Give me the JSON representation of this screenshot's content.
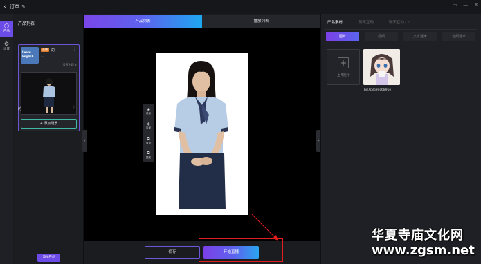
{
  "titlebar": {
    "back_icon": "‹",
    "title": "订单",
    "edit_icon": "✎",
    "window_controls": [
      "▭",
      "—",
      "✕"
    ]
  },
  "rail": [
    {
      "label": "产品",
      "icon": "cube-icon",
      "active": true
    },
    {
      "label": "设置",
      "icon": "gear-icon",
      "active": false
    }
  ],
  "product_panel": {
    "title": "产品列表",
    "card": {
      "thumb_text_1": "Learn",
      "thumb_text_2": "English",
      "badge": "直播",
      "name": "的",
      "subtitle": "…",
      "link": "设置主题 ∨",
      "scene_name": "的"
    },
    "add_scene_label": "+ 添加场景",
    "add_product_label": "添加产品"
  },
  "tabs": {
    "product_list": "产品列表",
    "playback_list": "播放列表"
  },
  "canvas_tools": [
    {
      "label": "前景",
      "icon": "layers-icon"
    },
    {
      "label": "后景",
      "icon": "layers-icon"
    },
    {
      "label": "置顶",
      "icon": "layer-up-icon"
    },
    {
      "label": "置底",
      "icon": "layer-down-icon"
    }
  ],
  "bottom": {
    "save_label": "保存",
    "start_label": "开始直播"
  },
  "right_panel": {
    "tabs": [
      "产品素材",
      "聊天互动",
      "聊天互动2.0"
    ],
    "subtabs": [
      "图片",
      "视频",
      "文本话术",
      "音频话术"
    ],
    "upload_label": "上传图片",
    "asset_name": "bd7c8b9dc6891e"
  },
  "watermark": {
    "line1": "华夏寺庙文化网",
    "line2": "www.zgsm.net"
  },
  "colors": {
    "accent": "#6b4ce6",
    "gradient_end": "#1ea7f0",
    "highlight": "#e21d1d"
  }
}
